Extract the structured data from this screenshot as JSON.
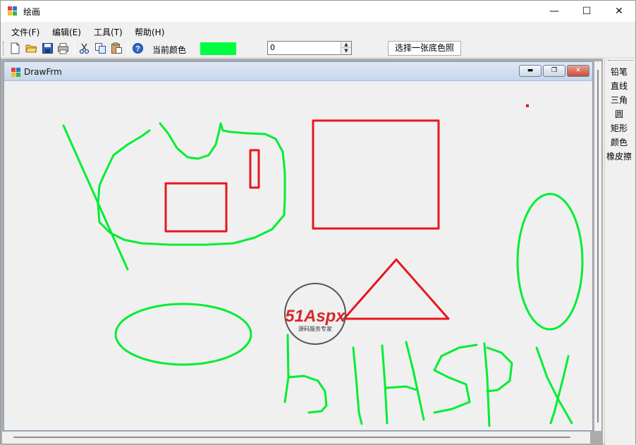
{
  "window": {
    "title": "绘画",
    "minimize_glyph": "—",
    "maximize_glyph": "☐",
    "close_glyph": "✕"
  },
  "menu": [
    "文件(F)",
    "编辑(E)",
    "工具(T)",
    "帮助(H)"
  ],
  "toolbar": {
    "icons": [
      "new-file-icon",
      "open-folder-icon",
      "save-icon",
      "print-icon",
      "cut-icon",
      "copy-icon",
      "paste-icon",
      "help-icon"
    ],
    "current_color_label": "当前颜色",
    "current_color": "#00ff40",
    "width_value": "0",
    "background_button": "选择一张底色照"
  },
  "child_window": {
    "title": "DrawFrm",
    "min_glyph": "▬",
    "max_glyph": "❐",
    "close_glyph": "✕"
  },
  "tools": [
    "铅笔",
    "直线",
    "三角",
    "圆",
    "矩形",
    "颜色",
    "橡皮擦"
  ],
  "watermark": {
    "brand": "51Aspx",
    "tagline": "源码服务专家"
  },
  "colors": {
    "stroke_green": "#00ee33",
    "stroke_red": "#e8161c"
  }
}
